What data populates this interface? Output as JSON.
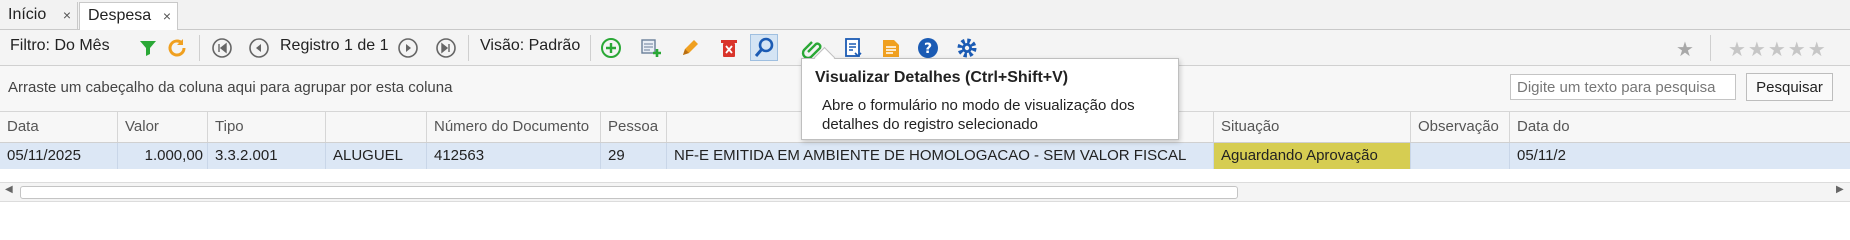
{
  "tabs": [
    {
      "label": "Início",
      "close": "×"
    },
    {
      "label": "Despesa",
      "close": "×"
    }
  ],
  "toolbar": {
    "filter_label": "Filtro: Do Mês",
    "record_label": "Registro 1 de 1",
    "view_label": "Visão: Padrão"
  },
  "icons": {
    "filter": "filter-icon",
    "refresh": "refresh-icon",
    "first": "first-record-icon",
    "prev": "previous-record-icon",
    "next": "next-record-icon",
    "last": "last-record-icon",
    "add": "add-icon",
    "copy": "copy-record-icon",
    "edit": "edit-pencil-icon",
    "delete": "delete-trash-icon",
    "view": "view-details-magnifier-icon",
    "attach": "attachment-clip-icon",
    "report": "report-icon",
    "document": "document-icon",
    "help": "help-icon",
    "settings": "gear-icon",
    "favorite": "favorite-star-icon",
    "rating": "rating-stars-icon"
  },
  "colors": {
    "selected_row": "#dce7f5",
    "status_highlight": "#d6cd52",
    "accent_orange": "#f0a020",
    "green": "#2aa836",
    "red": "#d9342b",
    "blue": "#1b5bb4"
  },
  "group_area": {
    "hint": "Arraste um cabeçalho da coluna aqui para agrupar por esta coluna",
    "search_placeholder": "Digite um texto para pesquisa",
    "search_button": "Pesquisar"
  },
  "columns": [
    "Data",
    "Valor",
    "Tipo",
    "",
    "Número do Documento",
    "Pessoa",
    "",
    "Situação",
    "Observação",
    "Data do"
  ],
  "rows": [
    {
      "data": "05/11/2025",
      "valor": "1.000,00",
      "tipo": "3.3.2.001",
      "categoria": "ALUGUEL",
      "numero": "412563",
      "pessoa": "29",
      "descricao": "NF-E EMITIDA EM AMBIENTE DE HOMOLOGACAO - SEM VALOR FISCAL",
      "situacao": "Aguardando Aprovação",
      "observacao": "",
      "data2": "05/11/2"
    }
  ],
  "tooltip": {
    "title": "Visualizar Detalhes (Ctrl+Shift+V)",
    "description": "Abre o formulário no modo de visualização dos detalhes do registro selecionado"
  },
  "scrollbar": {
    "left_arrow": "◀",
    "right_arrow": "▶"
  },
  "rating": {
    "single": "★",
    "stars": "★★★★★"
  }
}
